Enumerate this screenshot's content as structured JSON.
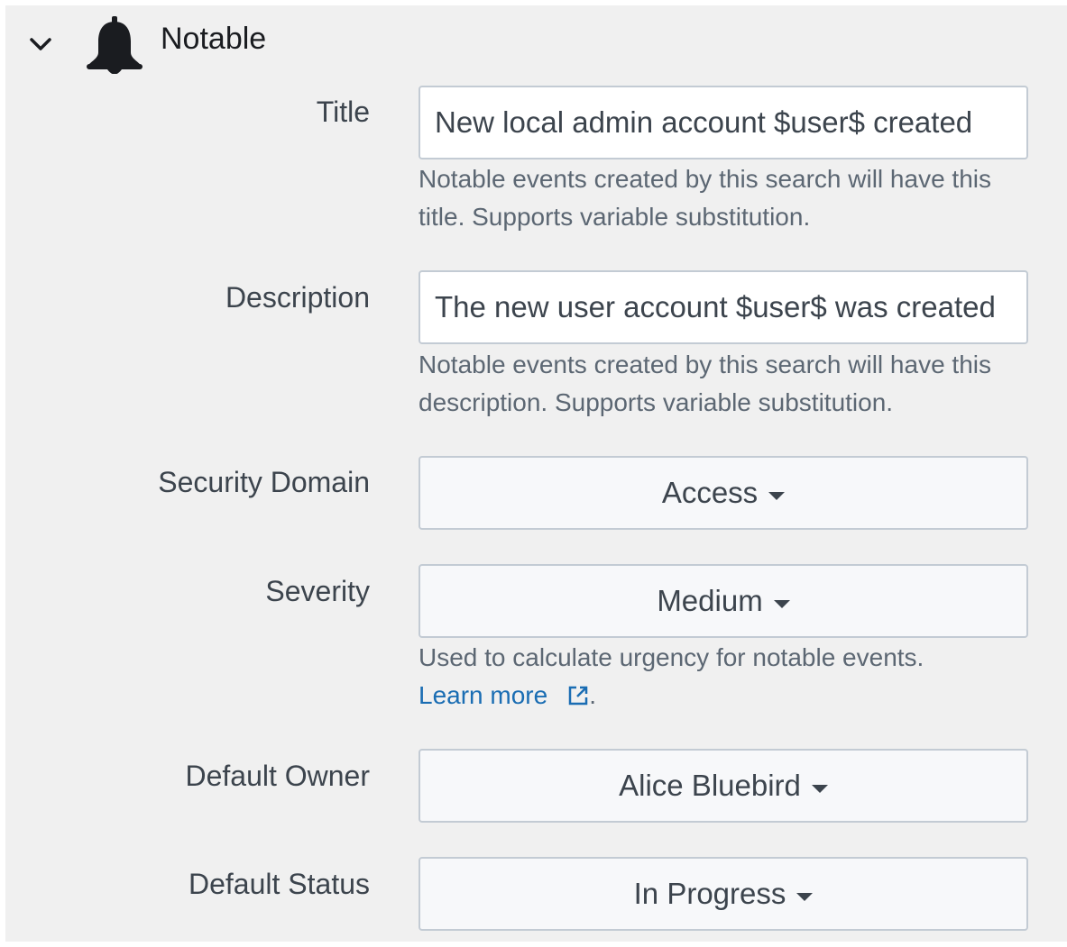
{
  "section": {
    "title": "Notable",
    "chevron_icon": "chevron-down-icon",
    "bell_icon": "bell-icon"
  },
  "fields": {
    "title": {
      "label": "Title",
      "value": "New local admin account $user$ created",
      "help": "Notable events created by this search will have this title. Supports variable substitution."
    },
    "description": {
      "label": "Description",
      "value": "The new user account $user$ was created",
      "help": "Notable events created by this search will have this description. Supports variable substitution."
    },
    "security_domain": {
      "label": "Security Domain",
      "value": "Access"
    },
    "severity": {
      "label": "Severity",
      "value": "Medium",
      "help": "Used to calculate urgency for notable events.",
      "link_text": "Learn more",
      "link_icon": "external-link-icon"
    },
    "default_owner": {
      "label": "Default Owner",
      "value": "Alice Bluebird"
    },
    "default_status": {
      "label": "Default Status",
      "value": "In Progress"
    }
  },
  "colors": {
    "panel_bg": "#f0f0f0",
    "text": "#3c444d",
    "help_text": "#5c6773",
    "link": "#1a6db3",
    "border": "#c3cbd4"
  }
}
